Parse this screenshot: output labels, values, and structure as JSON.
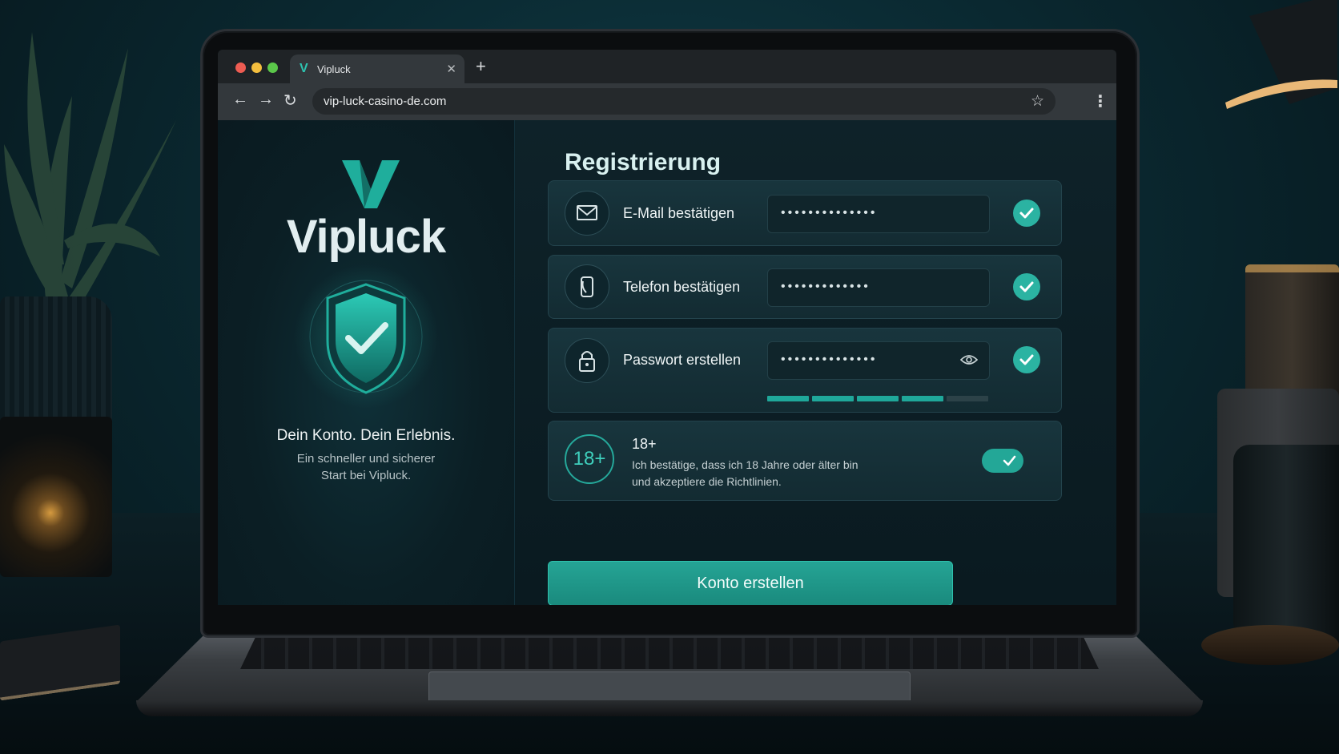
{
  "browser": {
    "tab_title": "Vipluck",
    "tab_logo": "V",
    "url": "vip-luck-casino-de.com"
  },
  "brand": {
    "name": "Vipluck",
    "tagline": "Dein Konto. Dein Erlebnis.",
    "subtagline": "Ein schneller und sicherer Start bei Vipluck."
  },
  "form": {
    "title": "Registrierung",
    "email": {
      "label": "E-Mail bestätigen",
      "value": "••••••••••••••",
      "verified": true
    },
    "phone": {
      "label": "Telefon bestätigen",
      "value": "•••••••••••••",
      "verified": true
    },
    "password": {
      "label": "Passwort erstellen",
      "value": "••••••••••••••",
      "verified": true,
      "strength": 0.8
    },
    "age": {
      "badge": "18+",
      "title": "18+",
      "text": "Ich bestätige, dass ich 18 Jahre oder älter bin und akzeptiere die Richtlinien.",
      "accepted": true
    },
    "submit_label": "Konto erstellen"
  },
  "colors": {
    "accent": "#2bb3a2",
    "background": "#0a1a20"
  },
  "icons": [
    "mail-icon",
    "phone-icon",
    "lock-icon",
    "eye-icon",
    "check-icon",
    "shield-icon",
    "star-icon",
    "back-icon",
    "forward-icon",
    "reload-icon",
    "menu-icon"
  ]
}
